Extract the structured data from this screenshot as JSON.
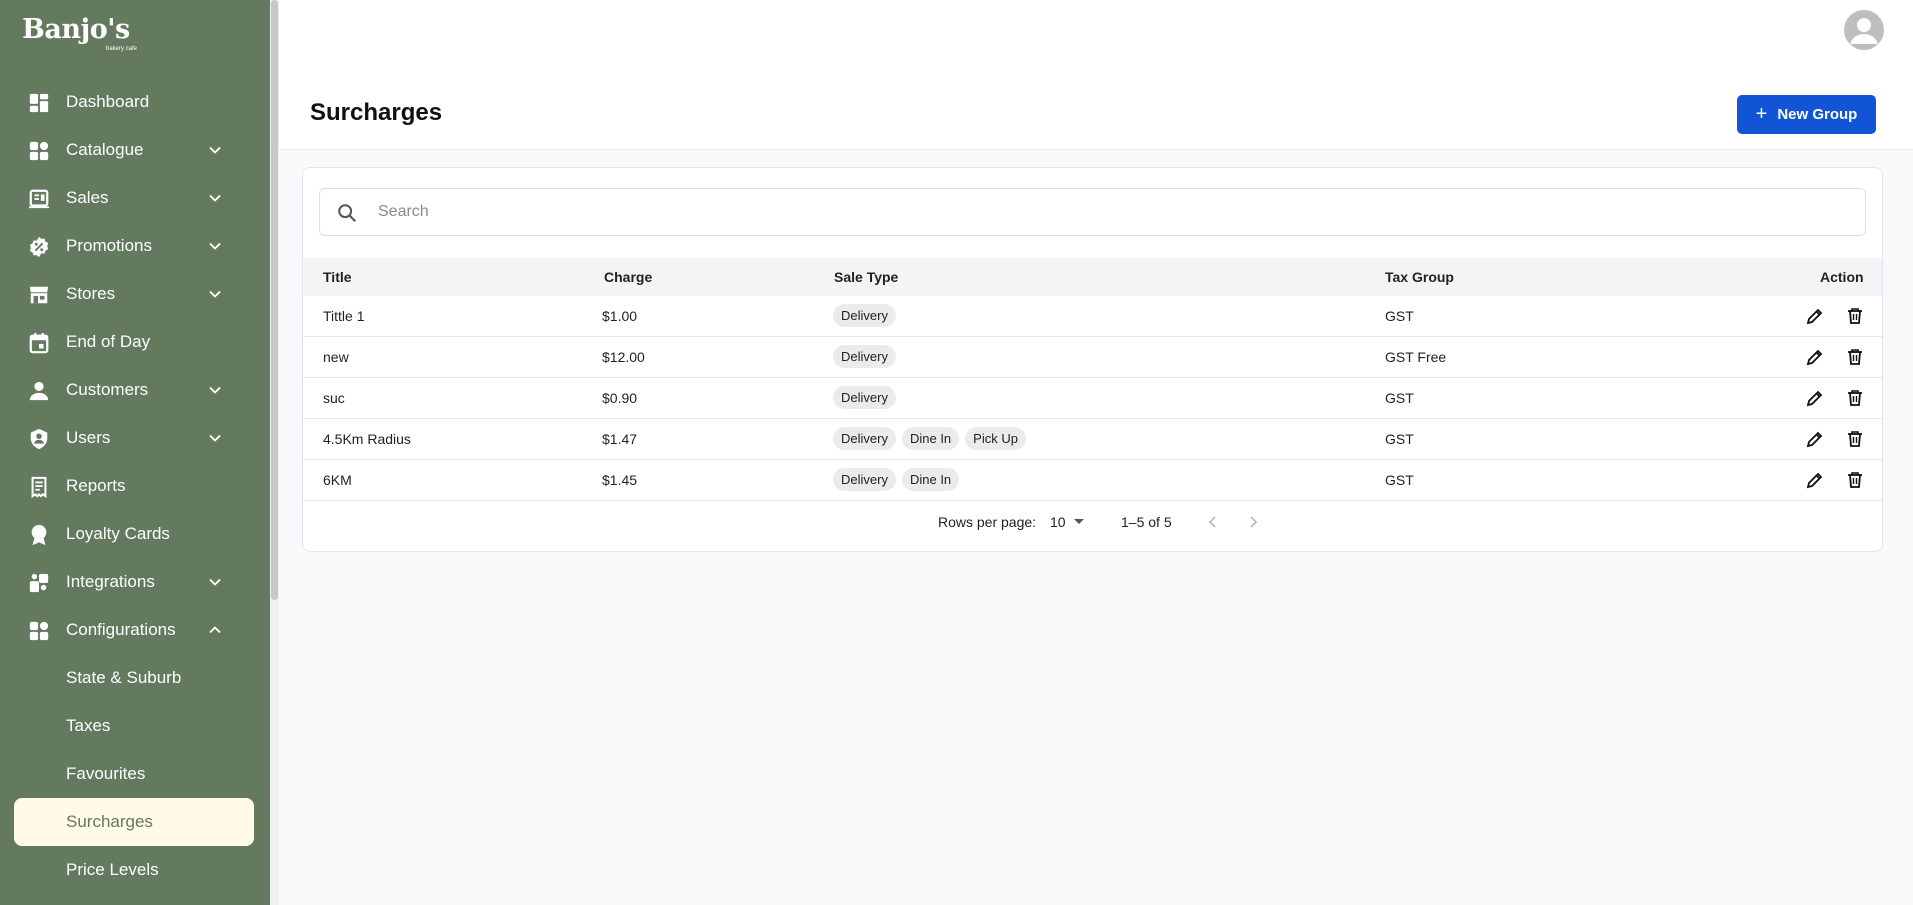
{
  "brand": {
    "logo_text": "Banjo's",
    "logo_sub": "bakery cafe"
  },
  "sidebar": {
    "items": [
      {
        "label": "Dashboard",
        "icon": "dashboard-icon",
        "expandable": false
      },
      {
        "label": "Catalogue",
        "icon": "catalogue-icon",
        "expandable": true
      },
      {
        "label": "Sales",
        "icon": "sales-icon",
        "expandable": true
      },
      {
        "label": "Promotions",
        "icon": "percent-badge-icon",
        "expandable": true
      },
      {
        "label": "Stores",
        "icon": "store-icon",
        "expandable": true
      },
      {
        "label": "End of Day",
        "icon": "calendar-icon",
        "expandable": false
      },
      {
        "label": "Customers",
        "icon": "person-icon",
        "expandable": true
      },
      {
        "label": "Users",
        "icon": "shield-user-icon",
        "expandable": true
      },
      {
        "label": "Reports",
        "icon": "receipt-icon",
        "expandable": false
      },
      {
        "label": "Loyalty Cards",
        "icon": "award-icon",
        "expandable": false
      },
      {
        "label": "Integrations",
        "icon": "integration-icon",
        "expandable": true
      },
      {
        "label": "Configurations",
        "icon": "configurations-icon",
        "expandable": true,
        "expanded": true
      }
    ],
    "subitems": [
      {
        "label": "State & Suburb"
      },
      {
        "label": "Taxes"
      },
      {
        "label": "Favourites"
      },
      {
        "label": "Surcharges",
        "active": true
      },
      {
        "label": "Price Levels"
      }
    ]
  },
  "header": {
    "title": "Surcharges",
    "new_button_label": "New Group"
  },
  "search": {
    "placeholder": "Search",
    "value": ""
  },
  "table": {
    "columns": [
      "Title",
      "Charge",
      "Sale Type",
      "Tax Group",
      "Action"
    ],
    "rows": [
      {
        "title": "Tittle 1",
        "charge": "$1.00",
        "sale_types": [
          "Delivery"
        ],
        "tax_group": "GST"
      },
      {
        "title": "new",
        "charge": "$12.00",
        "sale_types": [
          "Delivery"
        ],
        "tax_group": "GST Free"
      },
      {
        "title": "suc",
        "charge": "$0.90",
        "sale_types": [
          "Delivery"
        ],
        "tax_group": "GST"
      },
      {
        "title": "4.5Km Radius",
        "charge": "$1.47",
        "sale_types": [
          "Delivery",
          "Dine In",
          "Pick Up"
        ],
        "tax_group": "GST"
      },
      {
        "title": "6KM",
        "charge": "$1.45",
        "sale_types": [
          "Delivery",
          "Dine In"
        ],
        "tax_group": "GST"
      }
    ]
  },
  "pagination": {
    "rows_per_page_label": "Rows per page:",
    "rows_per_page": "10",
    "range": "1–5 of 5"
  },
  "colors": {
    "sidebar_bg": "#637a5f",
    "active_bg": "#fffbe6",
    "primary": "#1254d6"
  }
}
